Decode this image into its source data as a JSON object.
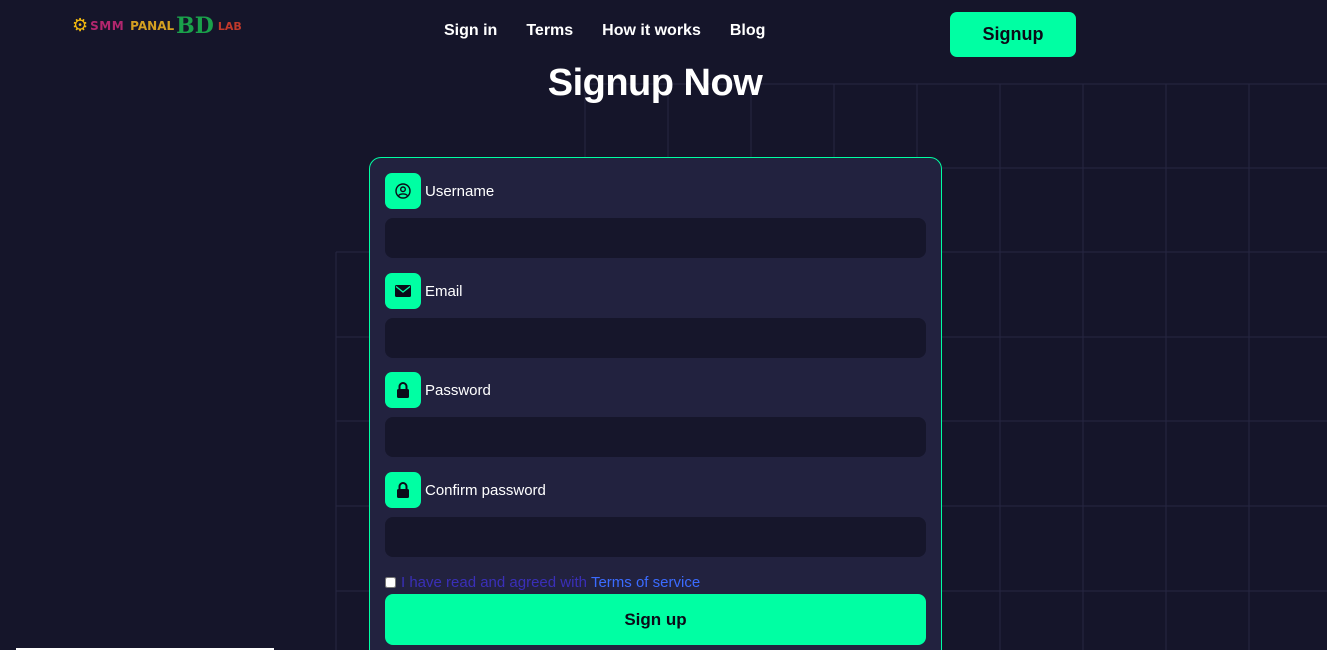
{
  "brand": {
    "logo_gear": "⚙",
    "logo_smm": "SMM",
    "logo_panal": "PANAL",
    "logo_bd": "BD",
    "logo_lab": "LAB"
  },
  "nav": {
    "items": [
      {
        "label": "Sign in"
      },
      {
        "label": "Terms"
      },
      {
        "label": "How it works"
      },
      {
        "label": "Blog"
      }
    ],
    "signup_label": "Signup"
  },
  "page": {
    "title": "Signup Now"
  },
  "form": {
    "username": {
      "label": "Username",
      "value": "",
      "icon": "user-circle-icon"
    },
    "email": {
      "label": "Email",
      "value": "",
      "icon": "envelope-icon"
    },
    "password": {
      "label": "Password",
      "value": "",
      "icon": "lock-icon"
    },
    "confirm_password": {
      "label": "Confirm password",
      "value": "",
      "icon": "lock-icon"
    },
    "terms_text": "I have read and agreed with",
    "terms_link": "Terms of service",
    "submit_label": "Sign up"
  },
  "colors": {
    "background": "#15152a",
    "card": "#22223f",
    "accent": "#00ffa3",
    "input": "#16162b",
    "link": "#3b6bff"
  }
}
